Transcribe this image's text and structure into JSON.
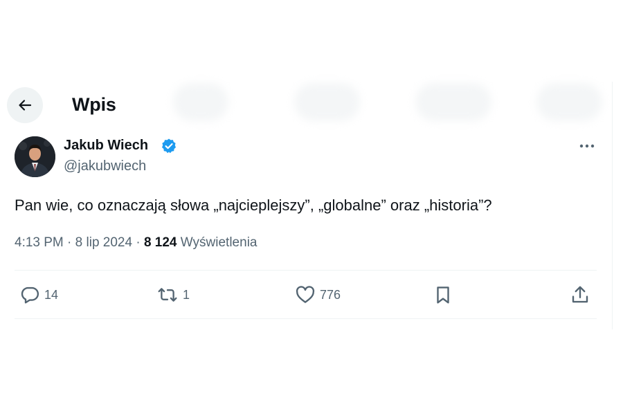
{
  "header": {
    "title": "Wpis",
    "back_icon": "arrow-left-icon"
  },
  "tweet": {
    "author_name": "Jakub Wiech",
    "author_handle": "@jakubwiech",
    "verified": true,
    "text": "Pan wie, co oznaczają słowa „najcieplejszy”, „globalne” oraz „historia”?",
    "time": "4:13 PM",
    "separator": "·",
    "date": "8 lip 2024",
    "views_count": "8 124",
    "views_label": "Wyświetlenia"
  },
  "actions": {
    "replies": "14",
    "reposts": "1",
    "likes": "776"
  },
  "colors": {
    "text": "#0f1419",
    "secondary": "#536471",
    "verified_blue": "#1d9bf0",
    "divider": "#eff3f4",
    "back_button_bg": "#eff3f4"
  },
  "icons": [
    "arrow-left-icon",
    "verified-badge-icon",
    "more-icon",
    "reply-icon",
    "repost-icon",
    "like-icon",
    "bookmark-icon",
    "share-icon"
  ]
}
